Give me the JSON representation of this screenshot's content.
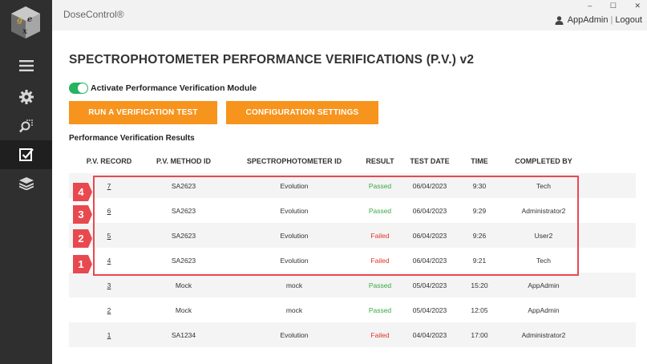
{
  "app": {
    "title": "DoseControl®"
  },
  "window": {
    "minimize_glyph": "‒",
    "maximize_glyph": "☐",
    "close_glyph": "✕"
  },
  "user": {
    "name": "AppAdmin",
    "separator": "|",
    "logout_label": "Logout"
  },
  "sidebar": {
    "items": [
      {
        "icon": "menu-icon",
        "active": false
      },
      {
        "icon": "gear-icon",
        "active": false
      },
      {
        "icon": "search-icon",
        "active": false
      },
      {
        "icon": "checkbox-icon",
        "active": true
      },
      {
        "icon": "layers-icon",
        "active": false
      }
    ]
  },
  "page": {
    "title": "SPECTROPHOTOMETER PERFORMANCE VERIFICATIONS (P.V.) v2",
    "toggle_label": "Activate Performance Verification Module",
    "toggle_on": true,
    "run_test_label": "RUN A VERIFICATION TEST",
    "config_label": "CONFIGURATION SETTINGS",
    "section_heading": "Performance Verification Results"
  },
  "table": {
    "headers": [
      "P.V. RECORD",
      "P.V. METHOD ID",
      "SPECTROPHOTOMETER ID",
      "RESULT",
      "TEST DATE",
      "TIME",
      "COMPLETED BY"
    ],
    "rows": [
      {
        "record": "7",
        "method": "SA2623",
        "spectro": "Evolution",
        "result": "Passed",
        "date": "06/04/2023",
        "time": "9:30",
        "by": "Tech"
      },
      {
        "record": "6",
        "method": "SA2623",
        "spectro": "Evolution",
        "result": "Passed",
        "date": "06/04/2023",
        "time": "9:29",
        "by": "Administrator2"
      },
      {
        "record": "5",
        "method": "SA2623",
        "spectro": "Evolution",
        "result": "Failed",
        "date": "06/04/2023",
        "time": "9:26",
        "by": "User2"
      },
      {
        "record": "4",
        "method": "SA2623",
        "spectro": "Evolution",
        "result": "Failed",
        "date": "06/04/2023",
        "time": "9:21",
        "by": "Tech"
      },
      {
        "record": "3",
        "method": "Mock",
        "spectro": "mock",
        "result": "Passed",
        "date": "05/04/2023",
        "time": "15:20",
        "by": "AppAdmin"
      },
      {
        "record": "2",
        "method": "Mock",
        "spectro": "mock",
        "result": "Passed",
        "date": "05/04/2023",
        "time": "12:05",
        "by": "AppAdmin"
      },
      {
        "record": "1",
        "method": "SA1234",
        "spectro": "Evolution",
        "result": "Failed",
        "date": "04/04/2023",
        "time": "17:00",
        "by": "Administrator2"
      }
    ]
  },
  "annotations": {
    "badges": [
      "4",
      "3",
      "2",
      "1"
    ]
  },
  "colors": {
    "accent": "#f7941d",
    "passed": "#3aa845",
    "failed": "#e2332b",
    "highlight": "#e8494f",
    "toggle_on": "#27b35f",
    "sidebar": "#2f2f2f"
  }
}
